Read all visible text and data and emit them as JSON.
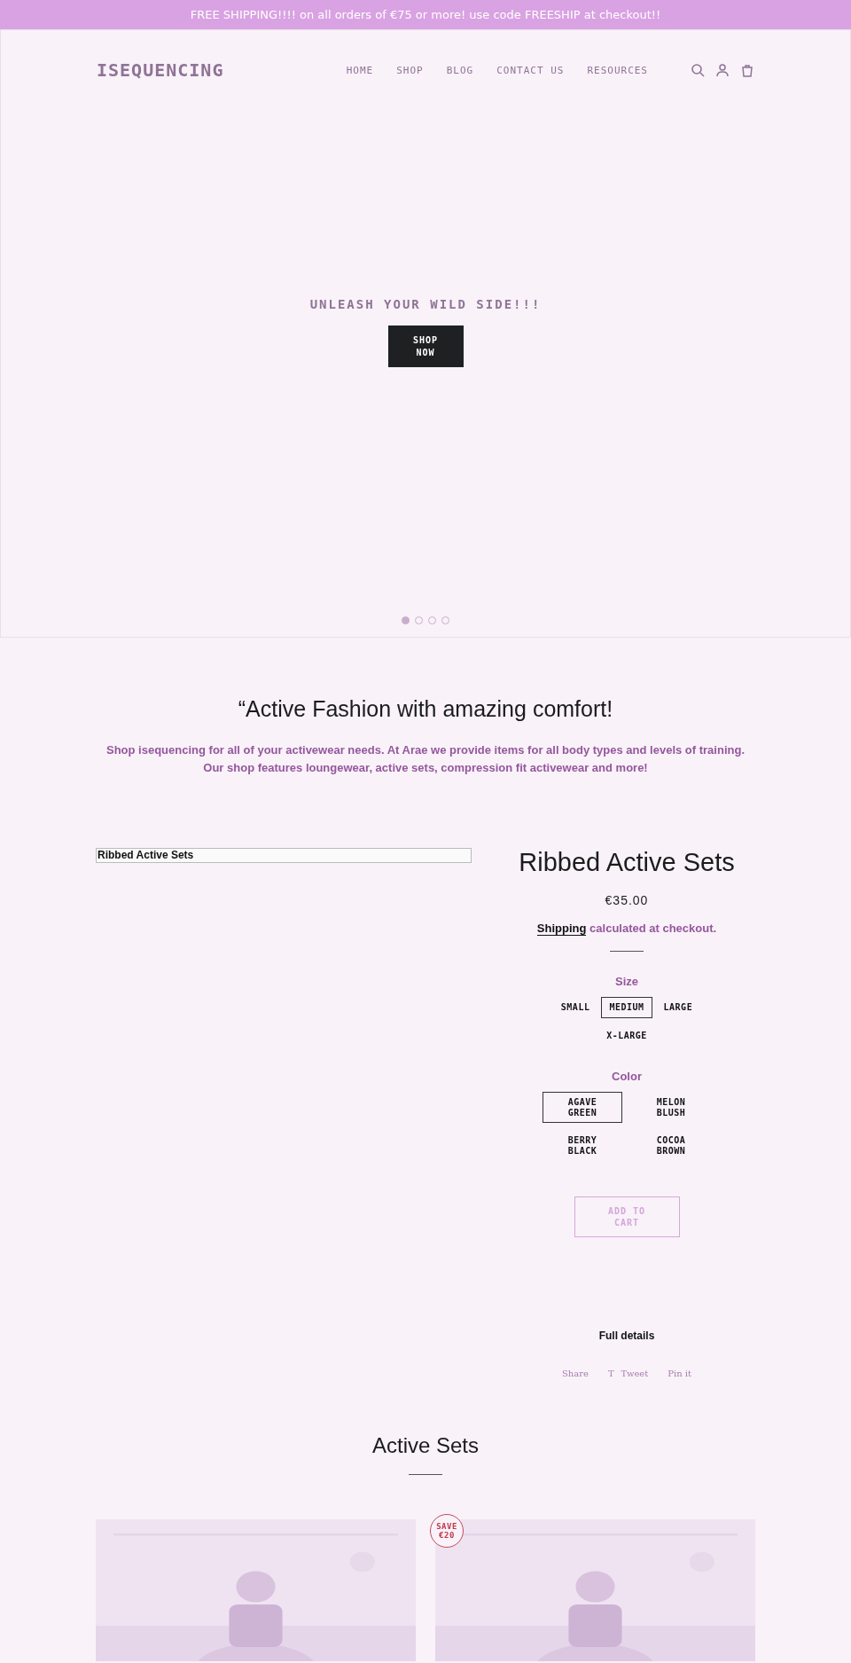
{
  "announcement": "FREE SHIPPING!!!! on all orders of €75 or more! use code FREESHIP at checkout!!",
  "header": {
    "logo": "ISEQUENCING",
    "nav": [
      "HOME",
      "SHOP",
      "BLOG",
      "CONTACT US",
      "RESOURCES"
    ],
    "icons": [
      {
        "kind": "search"
      },
      {
        "kind": "account"
      },
      {
        "kind": "cart"
      }
    ]
  },
  "hero": {
    "title": "UNLEASH YOUR WILD SIDE!!!",
    "button": "SHOP NOW",
    "slides": [
      {
        "selected": true
      },
      {
        "selected": false
      },
      {
        "selected": false
      },
      {
        "selected": false
      }
    ]
  },
  "intro": {
    "heading": "“Active Fashion with amazing comfort!",
    "text": "Shop isequencing for all of your activewear needs. At Arae we provide items for all body types and levels of training. Our shop features loungewear, active sets, compression fit activewear and more!"
  },
  "product": {
    "image_alt": "Ribbed Active Sets",
    "title": "Ribbed Active Sets",
    "price": "€35.00",
    "shipping_link": "Shipping",
    "shipping_text": "calculated at checkout.",
    "size_label": "Size",
    "sizes": [
      {
        "label": "SMALL",
        "selected": false
      },
      {
        "label": "MEDIUM",
        "selected": true
      },
      {
        "label": "LARGE",
        "selected": false
      },
      {
        "label": "X-LARGE",
        "selected": false
      }
    ],
    "color_label": "Color",
    "colors": [
      {
        "label": "AGAVE GREEN",
        "selected": true
      },
      {
        "label": "MELON BLUSH",
        "selected": false
      },
      {
        "label": "BERRY BLACK",
        "selected": false
      },
      {
        "label": "COCOA BROWN",
        "selected": false
      }
    ],
    "add_to_cart": {
      "label": "ADD TO CART",
      "disabled": true
    },
    "full_details": "Full details",
    "share": [
      {
        "label": "Share"
      },
      {
        "label": "Tweet",
        "glyph": "T"
      },
      {
        "label": "Pin it"
      }
    ]
  },
  "collection": {
    "heading": "Active Sets",
    "cards": [
      {
        "kind": "picture"
      },
      {
        "kind": "picture",
        "badge": "SAVE €20"
      }
    ]
  }
}
